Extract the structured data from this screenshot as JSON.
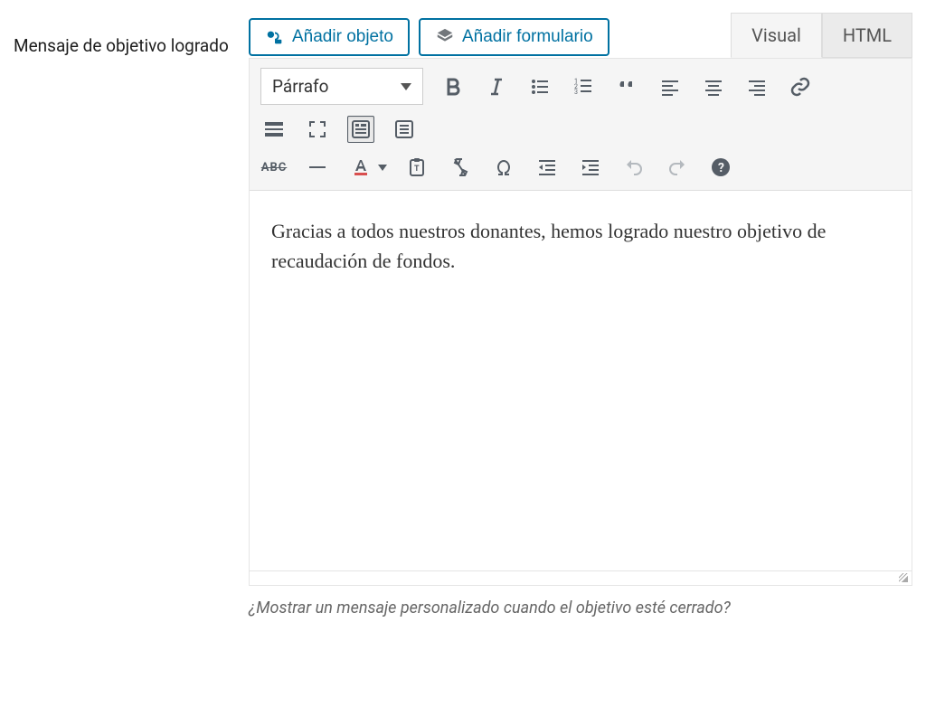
{
  "field": {
    "label": "Mensaje de objetivo logrado"
  },
  "media_buttons": {
    "add_object": "Añadir objeto",
    "add_form": "Añadir formulario"
  },
  "tabs": {
    "visual": "Visual",
    "html": "HTML"
  },
  "toolbar": {
    "format_select": "Párrafo"
  },
  "editor": {
    "content": "Gracias a todos nuestros donantes, hemos logrado nuestro objetivo de recaudación de fondos."
  },
  "helper": {
    "text": "¿Mostrar un mensaje personalizado cuando el objetivo esté cerrado?"
  },
  "icons": {
    "strikethrough_label": "ABC"
  }
}
